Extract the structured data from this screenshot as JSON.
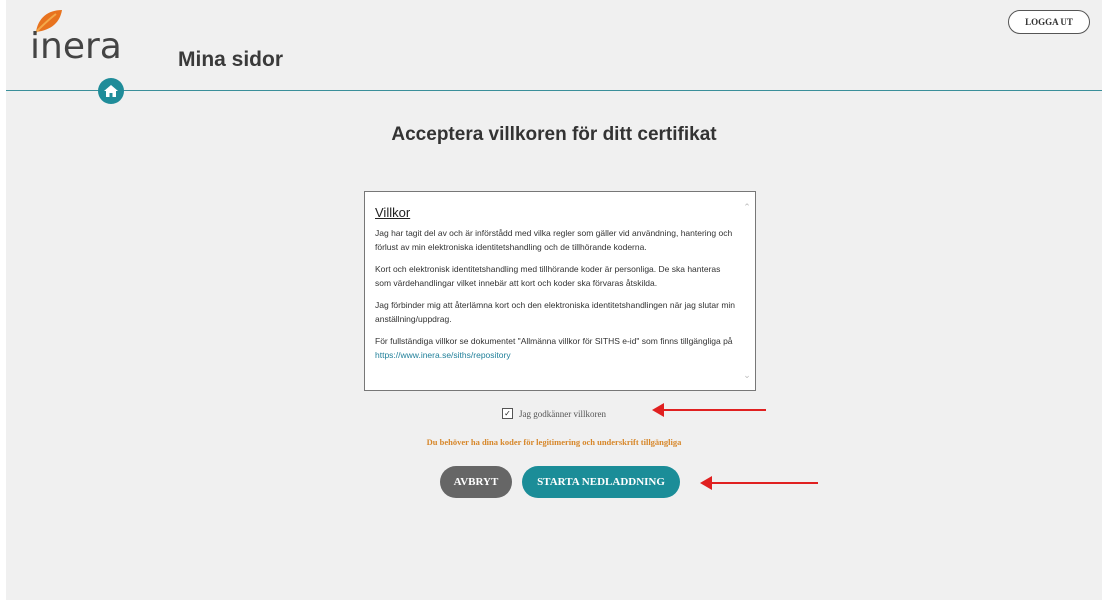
{
  "header": {
    "logo_text": "inera",
    "site_title": "Mina sidor",
    "logout_label": "LOGGA UT"
  },
  "main": {
    "title": "Acceptera villkoren för ditt certifikat"
  },
  "terms": {
    "heading": "Villkor",
    "p1": "Jag har tagit del av och är införstådd med vilka regler som gäller vid användning, hantering och förlust av min elektroniska identitetshandling och de tillhörande koderna.",
    "p2": "Kort och elektronisk identitetshandling med tillhörande koder är personliga. De ska hanteras som värdehandlingar vilket innebär att kort och koder ska förvaras åtskilda.",
    "p3": "Jag förbinder mig att återlämna kort och den elektroniska identitetshandlingen när jag slutar min anställning/uppdrag.",
    "p4_prefix": "För fullständiga villkor se dokumentet \"Allmänna villkor för SITHS e-id\" som finns tillgängliga på ",
    "link": "https://www.inera.se/siths/repository"
  },
  "accept": {
    "label": "Jag godkänner villkoren",
    "checked": true
  },
  "notice": "Du behöver ha dina koder för legitimering och underskrift tillgängliga",
  "buttons": {
    "cancel": "AVBRYT",
    "start": "STARTA NEDLADDNING"
  },
  "colors": {
    "accent": "#1b8d98",
    "notice": "#d7872a",
    "cancel": "#666666",
    "arrow": "#e02020"
  }
}
